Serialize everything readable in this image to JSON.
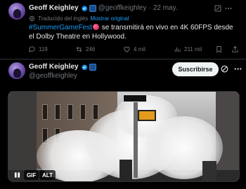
{
  "tweet1": {
    "author_name": "Geoff Keighley",
    "handle": "@geoffkeighley",
    "separator": "·",
    "date": "22 may.",
    "translated_label": "Traducido del inglés",
    "show_original": "Mostrar original",
    "hashtag": "#SummerGameFest",
    "text_after_hashtag": " se transmitirá en vivo en 4K 60FPS desde el Dolby Theatre en Hollywood.",
    "actions": {
      "replies": "119",
      "reposts": "246",
      "likes": "4 mil",
      "views": "211 mil"
    }
  },
  "tweet2": {
    "author_name": "Geoff Keighley",
    "handle": "@geoffkeighley",
    "follow_label": "Suscribirse",
    "media": {
      "gif_badge": "GIF",
      "alt_badge": "ALT"
    }
  },
  "colors": {
    "background": "#000000",
    "link": "#1d9bf0",
    "muted": "#71767b",
    "verified": "#1d9bf0"
  },
  "icons": [
    "grok-icon",
    "more-icon",
    "translate-icon",
    "reply-icon",
    "repost-icon",
    "like-icon",
    "views-icon",
    "bookmark-icon",
    "share-icon",
    "verified-badge-icon",
    "affiliate-badge-icon",
    "pause-icon"
  ]
}
